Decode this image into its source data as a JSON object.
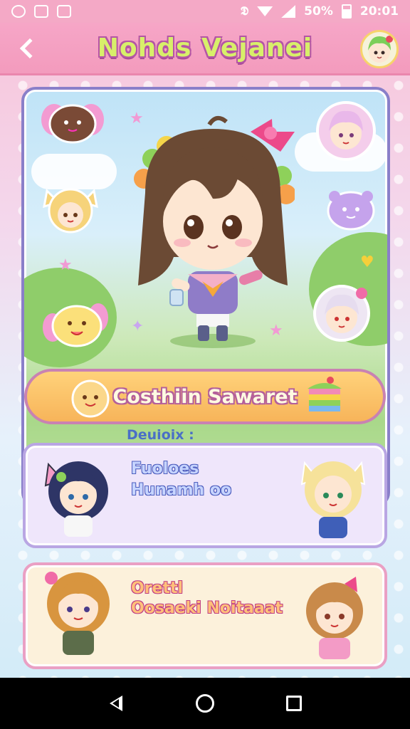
{
  "status_bar": {
    "battery": "50%",
    "time": "20:01"
  },
  "header": {
    "title": "Nohds Vejanei"
  },
  "hero": {
    "banner_text": "Costhiin Sawaret"
  },
  "section": {
    "label": "Deuioix :"
  },
  "cards": [
    {
      "line1": "Fuoloes",
      "line2": "Hunamh oo"
    },
    {
      "line1": "Orettl",
      "line2": "Oosaeki Noitaaat"
    }
  ],
  "colors": {
    "header_pink": "#f39bbd",
    "title_green": "#d8ef6a",
    "banner_orange": "#f7b45a",
    "card_lavender": "#efe6fb",
    "card_cream": "#fcf1db"
  }
}
